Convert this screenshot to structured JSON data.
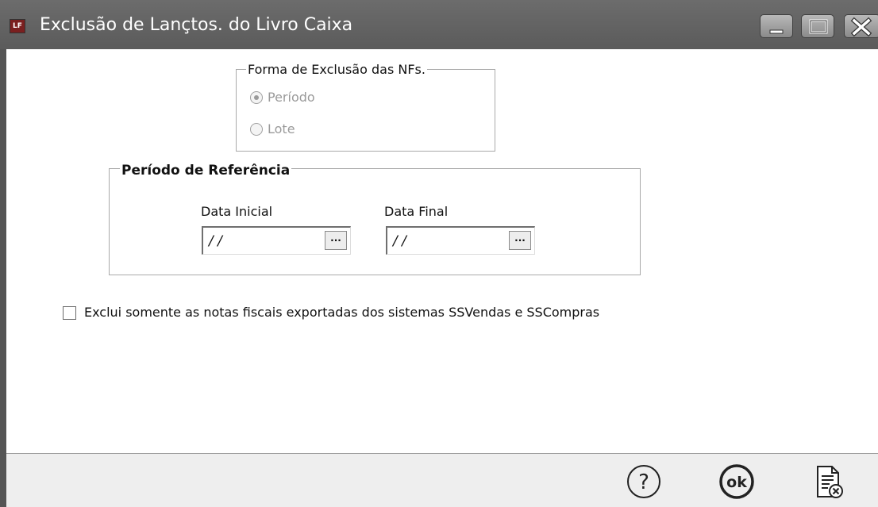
{
  "window": {
    "title": "Exclusão de Lançtos. do Livro Caixa",
    "icon_text": "LF",
    "controls": [
      "minimize-icon",
      "maximize-icon",
      "close-icon"
    ]
  },
  "forma": {
    "legend": "Forma de Exclusão das NFs.",
    "options": [
      {
        "label": "Período",
        "selected": true,
        "enabled": false
      },
      {
        "label": "Lote",
        "selected": false,
        "enabled": false
      }
    ]
  },
  "periodo": {
    "legend": "Período de Referência",
    "data_inicial": {
      "label": "Data Inicial",
      "value": "/ /",
      "button": "..."
    },
    "data_final": {
      "label": "Data Final",
      "value": "/ /",
      "button": "..."
    }
  },
  "checkbox": {
    "label": "Exclui somente as notas fiscais exportadas dos sistemas SSVendas e SSCompras",
    "checked": false
  },
  "footer": {
    "buttons": [
      {
        "icon": "help-icon",
        "text": "?"
      },
      {
        "icon": "ok-icon",
        "text": "ok"
      },
      {
        "icon": "close-document-icon"
      }
    ]
  },
  "colors": {
    "titlebar": "#5e5e5e",
    "disabled_text": "#9a9a9a",
    "footer_bg": "#eeeeee"
  }
}
